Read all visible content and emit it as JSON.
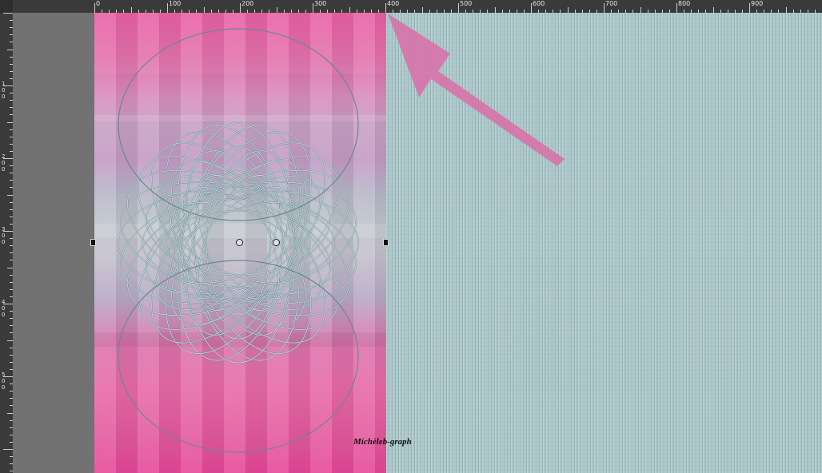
{
  "ruler": {
    "top_labels": [
      "0",
      "100",
      "200",
      "300",
      "400",
      "500",
      "600",
      "700",
      "800",
      "900"
    ],
    "left_labels": [
      "100",
      "200",
      "300",
      "400",
      "500"
    ]
  },
  "canvas": {
    "watermark": "Michèleb-graph",
    "texture_color": "#a9c6c9",
    "layer_color": "#e6489a",
    "arrow_color": "#d872aa"
  },
  "icons": {
    "handles": "transform-handle-icon",
    "pivot": "rotation-pivot-icon"
  }
}
